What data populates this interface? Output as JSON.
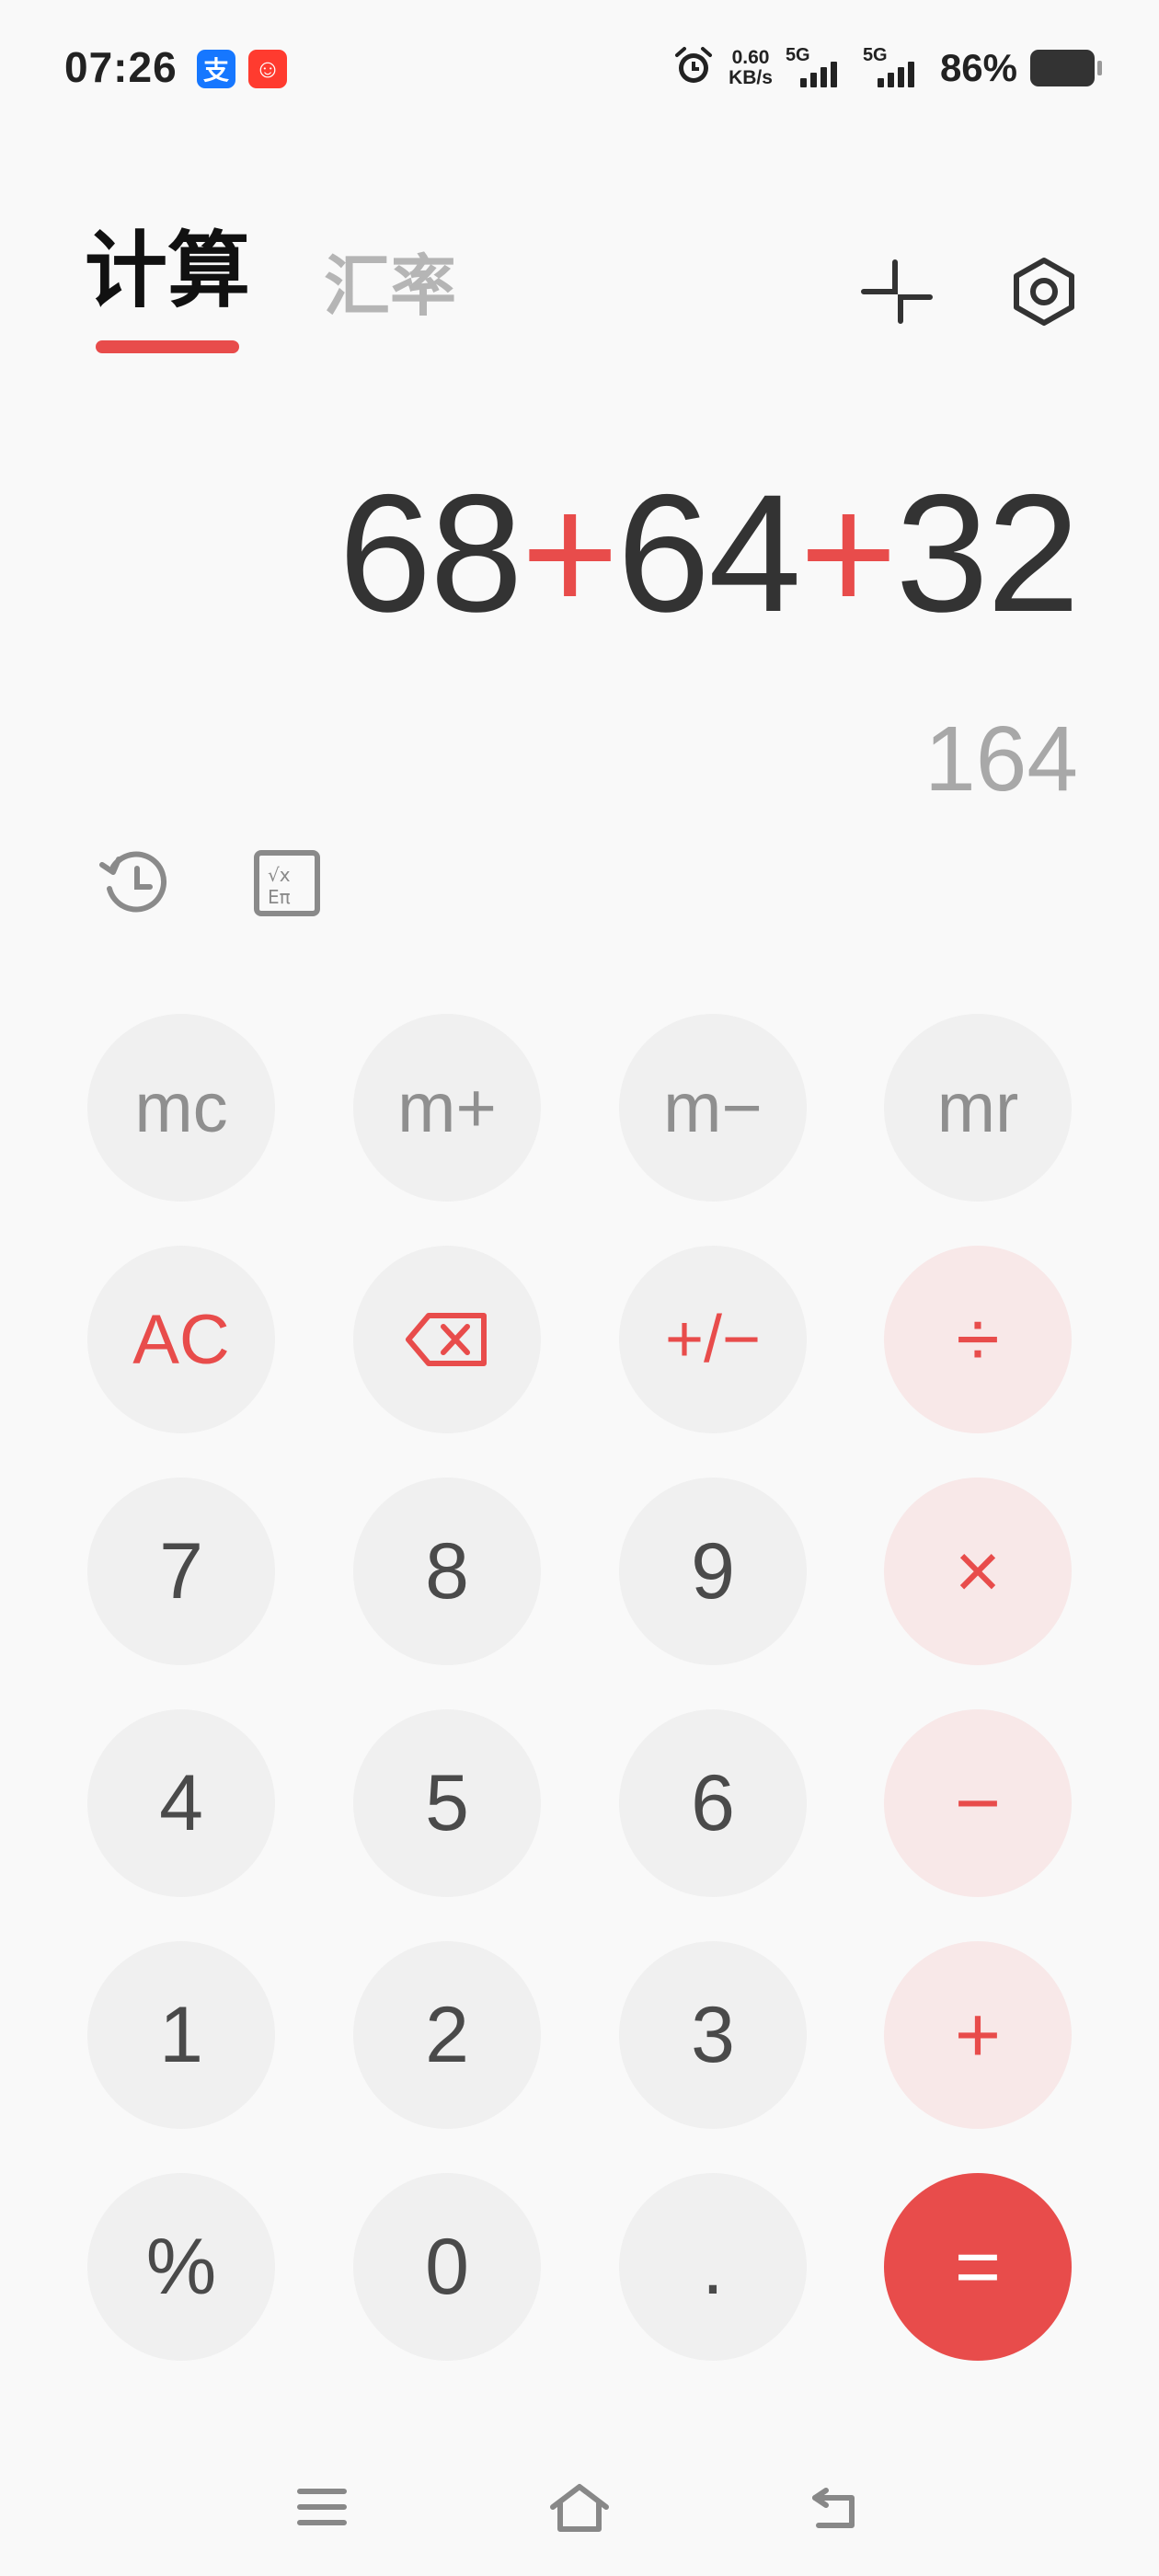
{
  "status_bar": {
    "time": "07:26",
    "apps": [
      {
        "name": "alipay",
        "glyph": "支"
      },
      {
        "name": "taobao",
        "glyph": "☺"
      }
    ],
    "net_speed_value": "0.60",
    "net_speed_unit": "KB/s",
    "signal1_label": "5G",
    "signal2_label": "5G",
    "battery_percent": "86%"
  },
  "tabs": [
    {
      "label": "计算",
      "active": true
    },
    {
      "label": "汇率",
      "active": false
    }
  ],
  "toolbar_icons": [
    "minimize-icon",
    "settings-icon"
  ],
  "display": {
    "expression": [
      {
        "text": "68",
        "type": "num"
      },
      {
        "text": "+",
        "type": "op"
      },
      {
        "text": "64",
        "type": "num"
      },
      {
        "text": "+",
        "type": "op"
      },
      {
        "text": "32",
        "type": "num"
      }
    ],
    "result": "164"
  },
  "tool_icons": [
    "history-icon",
    "scientific-icon"
  ],
  "keys": {
    "mc": "mc",
    "m_plus": "m+",
    "m_minus": "m−",
    "mr": "mr",
    "ac": "AC",
    "backspace": "backspace-icon",
    "plus_minus": "+/−",
    "divide": "÷",
    "seven": "7",
    "eight": "8",
    "nine": "9",
    "multiply": "×",
    "four": "4",
    "five": "5",
    "six": "6",
    "minus": "−",
    "one": "1",
    "two": "2",
    "three": "3",
    "plus": "+",
    "percent": "%",
    "zero": "0",
    "dot": ".",
    "equals": "="
  },
  "colors": {
    "accent": "#e84c4b",
    "key_bg": "#f0f0f0",
    "op_key_bg": "#f8e8e8",
    "background": "#f9f9f9"
  },
  "nav_icons": [
    "menu-icon",
    "home-icon",
    "back-icon"
  ]
}
